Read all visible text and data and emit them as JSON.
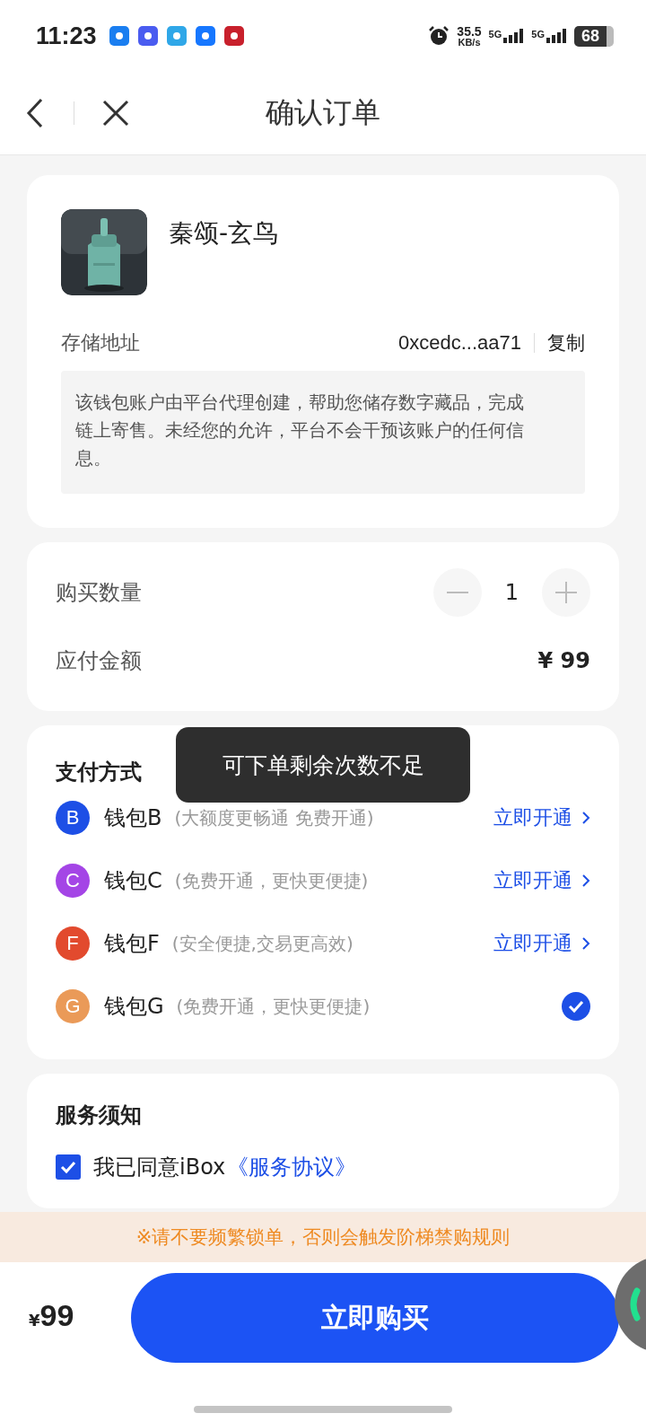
{
  "status_bar": {
    "time": "11:23",
    "speed": "35.5",
    "speed_unit": "KB/s",
    "network_1": "5G",
    "network_2": "5G",
    "battery": "68"
  },
  "nav": {
    "title": "确认订单"
  },
  "product": {
    "name": "秦颂-玄鸟",
    "address_label": "存储地址",
    "address": "0xcedc...aa71",
    "copy": "复制",
    "note": "该钱包账户由平台代理创建，帮助您储存数字藏品，完成链上寄售。未经您的允许，平台不会干预该账户的任何信息。"
  },
  "order": {
    "quantity_label": "购买数量",
    "quantity": "1",
    "amount_label": "应付金额",
    "amount": "¥ 99"
  },
  "payment": {
    "title": "支付方式",
    "methods": [
      {
        "letter": "B",
        "name": "钱包B",
        "hint": "(大额度更畅通 免费开通)",
        "color": "#1d4fe6",
        "selected": false,
        "action": "立即开通"
      },
      {
        "letter": "C",
        "name": "钱包C",
        "hint": "(免费开通，更快更便捷)",
        "color": "#a445e6",
        "selected": false,
        "action": "立即开通"
      },
      {
        "letter": "F",
        "name": "钱包F",
        "hint": "(安全便捷,交易更高效)",
        "color": "#e24a2e",
        "selected": false,
        "action": "立即开通"
      },
      {
        "letter": "G",
        "name": "钱包G",
        "hint": "(免费开通，更快更便捷)",
        "color": "#ea9a58",
        "selected": true
      }
    ]
  },
  "service": {
    "title": "服务须知",
    "checked": true,
    "agree_text": "我已同意iBox",
    "agreement_link": "《服务协议》"
  },
  "warning": "※请不要频繁锁单，否则会触发阶梯禁购规则",
  "footer": {
    "currency": "¥",
    "price": "99",
    "button": "立即购买"
  },
  "toast": "可下单剩余次数不足"
}
